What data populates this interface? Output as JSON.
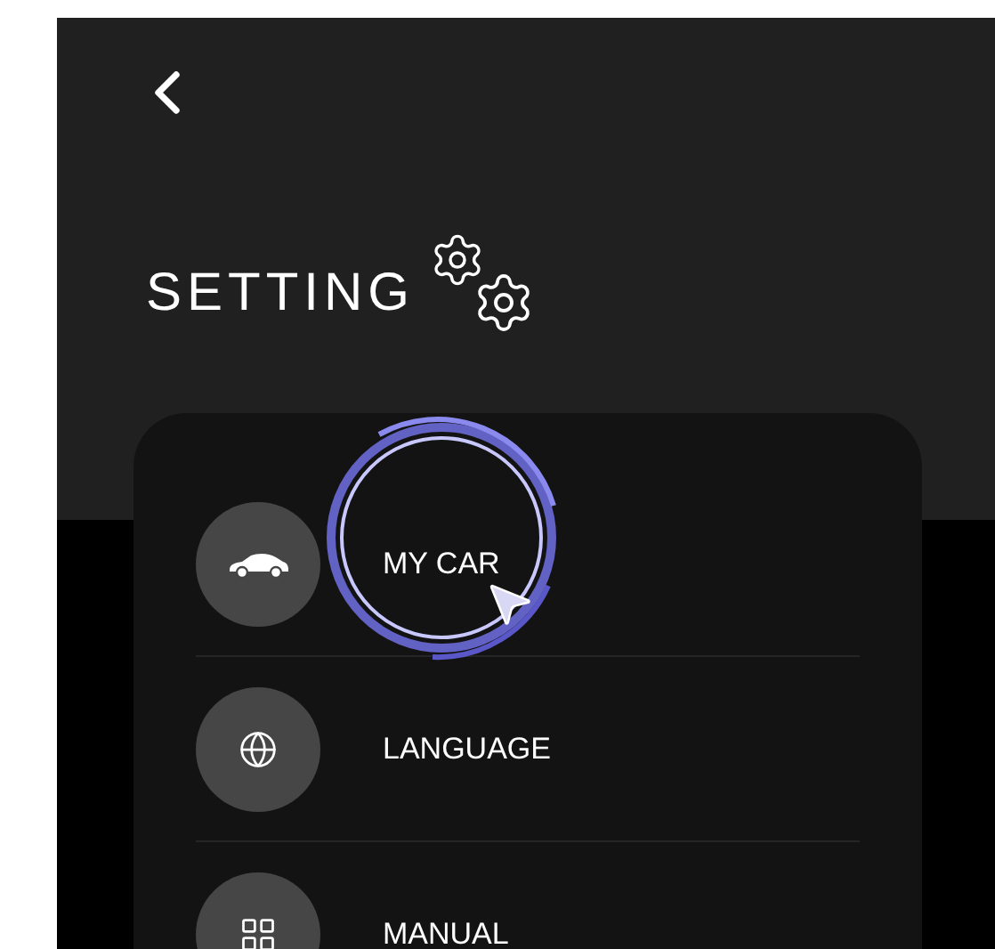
{
  "header": {
    "title": "SETTING"
  },
  "menu": [
    {
      "kind": "car",
      "label": "MY CAR"
    },
    {
      "kind": "language",
      "label": "LANGUAGE"
    },
    {
      "kind": "manual",
      "label": "MANUAL"
    }
  ]
}
